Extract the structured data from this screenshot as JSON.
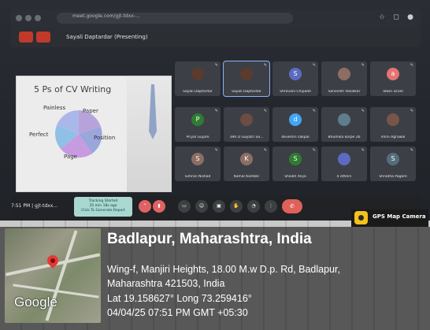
{
  "browser": {
    "url": "meet.google.com/gjt-tdxx-..."
  },
  "meet": {
    "presenting_label": "Sayali Daptardar (Presenting)",
    "time": "7:51 PM",
    "meeting_code": "gjt-tdxx...",
    "tracking_lines": [
      "Tracking Started",
      "35 min 18s ago",
      "Click To Generate Report"
    ]
  },
  "slide": {
    "title": "5 Ps of CV Writing",
    "labels": [
      "Painless",
      "Paper",
      "Perfect",
      "Position",
      "Page"
    ]
  },
  "tiles": [
    {
      "name": "Sayali Daptardar",
      "avatar": "",
      "color": "#5a3b2e"
    },
    {
      "name": "Sayali Daptardar",
      "avatar": "",
      "color": "#5a3b2e"
    },
    {
      "name": "Shravani Chipade",
      "avatar": "S",
      "color": "#5c6bc0"
    },
    {
      "name": "Saneelsh Vasalkar",
      "avatar": "",
      "color": "#8d6e63"
    },
    {
      "name": "alwin israel",
      "avatar": "a",
      "color": "#e57373"
    },
    {
      "name": "Priyal Gujare",
      "avatar": "P",
      "color": "#2e7d32"
    },
    {
      "name": "390 D Gayatri Sa...",
      "avatar": "",
      "color": "#6d4c41"
    },
    {
      "name": "deveshri sakpal",
      "avatar": "d",
      "color": "#42a5f5"
    },
    {
      "name": "Bhumika korpe 26",
      "avatar": "",
      "color": "#607d8b"
    },
    {
      "name": "Vinni Agrawal",
      "avatar": "",
      "color": "#795548"
    },
    {
      "name": "Simran Nishad",
      "avatar": "S",
      "color": "#8d6e63"
    },
    {
      "name": "Komal Kamble",
      "avatar": "K",
      "color": "#8d6e63"
    },
    {
      "name": "Shaikh Aliya",
      "avatar": "S",
      "color": "#2e7d32"
    },
    {
      "name": "4 others",
      "avatar": "",
      "color": "#5c6bc0"
    },
    {
      "name": "Shradha Pagare",
      "avatar": "S",
      "color": "#546e7a"
    }
  ],
  "gps": {
    "app_name": "GPS Map Camera",
    "map_label": "Google",
    "location": "Badlapur, Maharashtra, India",
    "address_line1": "Wing-f, Manjiri Heights, 18.00 M.w D.p. Rd, Badlapur,",
    "address_line2": "Maharashtra 421503, India",
    "coords": "Lat 19.158627° Long 73.259416°",
    "datetime": "04/04/25 07:51 PM GMT +05:30"
  },
  "colors": {
    "end_call": "#e0605a",
    "gps_icon": "#f4c21b",
    "pin": "#e53935"
  }
}
